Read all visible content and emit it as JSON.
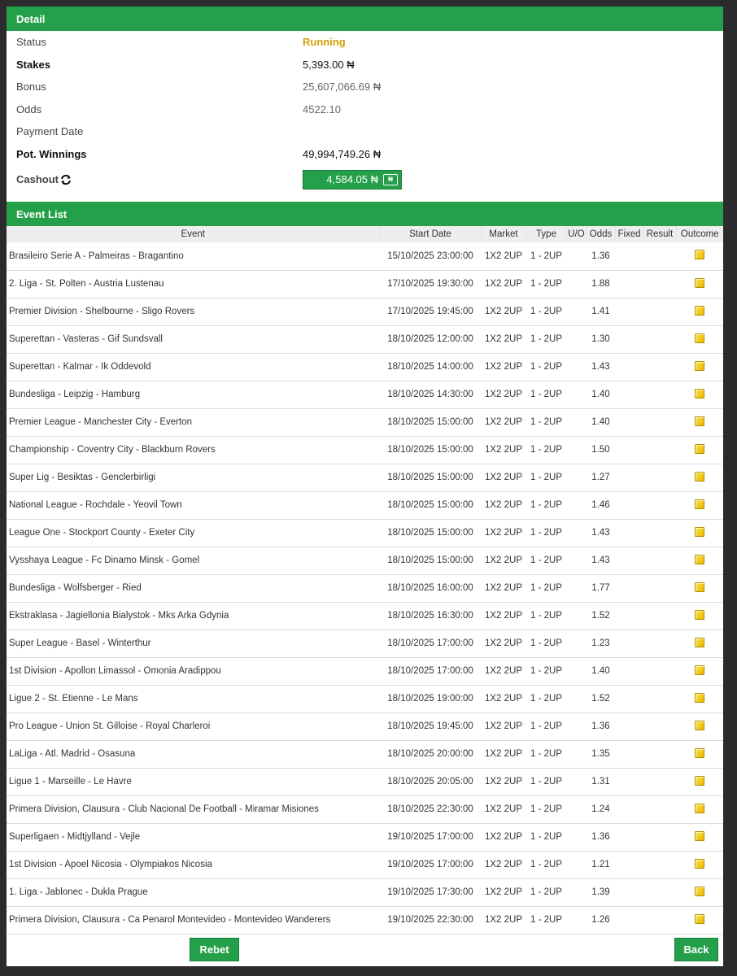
{
  "detail": {
    "header": "Detail",
    "rows": [
      {
        "label": "Status",
        "value": "Running"
      },
      {
        "label": "Stakes",
        "value": "5,393.00 ₦"
      },
      {
        "label": "Bonus",
        "value": "25,607,066.69 ₦"
      },
      {
        "label": "Odds",
        "value": "4522.10"
      },
      {
        "label": "Payment Date",
        "value": ""
      },
      {
        "label": "Pot. Winnings",
        "value": "49,994,749.26 ₦"
      }
    ],
    "cashout_label": "Cashout",
    "cashout_icon": "refresh-icon",
    "cashout_value": "4,584.05 ₦",
    "cashout_button_icon": "cash-note-icon",
    "cashout_button_icon_glyph": "₦"
  },
  "events": {
    "header": "Event List",
    "columns": [
      "Event",
      "Start Date",
      "Market",
      "Type",
      "U/O",
      "Odds",
      "Fixed",
      "Result",
      "Outcome"
    ],
    "rows": [
      {
        "event": "Brasileiro Serie A - Palmeiras - Bragantino",
        "start": "15/10/2025 23:00:00",
        "market": "1X2 2UP",
        "type": "1 - 2UP",
        "uo": "",
        "odds": "1.36",
        "fixed": "",
        "result": ""
      },
      {
        "event": "2. Liga - St. Polten - Austria Lustenau",
        "start": "17/10/2025 19:30:00",
        "market": "1X2 2UP",
        "type": "1 - 2UP",
        "uo": "",
        "odds": "1.88",
        "fixed": "",
        "result": ""
      },
      {
        "event": "Premier Division - Shelbourne - Sligo Rovers",
        "start": "17/10/2025 19:45:00",
        "market": "1X2 2UP",
        "type": "1 - 2UP",
        "uo": "",
        "odds": "1.41",
        "fixed": "",
        "result": ""
      },
      {
        "event": "Superettan - Vasteras - Gif Sundsvall",
        "start": "18/10/2025 12:00:00",
        "market": "1X2 2UP",
        "type": "1 - 2UP",
        "uo": "",
        "odds": "1.30",
        "fixed": "",
        "result": ""
      },
      {
        "event": "Superettan - Kalmar - Ik Oddevold",
        "start": "18/10/2025 14:00:00",
        "market": "1X2 2UP",
        "type": "1 - 2UP",
        "uo": "",
        "odds": "1.43",
        "fixed": "",
        "result": ""
      },
      {
        "event": "Bundesliga - Leipzig - Hamburg",
        "start": "18/10/2025 14:30:00",
        "market": "1X2 2UP",
        "type": "1 - 2UP",
        "uo": "",
        "odds": "1.40",
        "fixed": "",
        "result": ""
      },
      {
        "event": "Premier League - Manchester City - Everton",
        "start": "18/10/2025 15:00:00",
        "market": "1X2 2UP",
        "type": "1 - 2UP",
        "uo": "",
        "odds": "1.40",
        "fixed": "",
        "result": ""
      },
      {
        "event": "Championship - Coventry City - Blackburn Rovers",
        "start": "18/10/2025 15:00:00",
        "market": "1X2 2UP",
        "type": "1 - 2UP",
        "uo": "",
        "odds": "1.50",
        "fixed": "",
        "result": ""
      },
      {
        "event": "Super Lig - Besiktas - Genclerbirligi",
        "start": "18/10/2025 15:00:00",
        "market": "1X2 2UP",
        "type": "1 - 2UP",
        "uo": "",
        "odds": "1.27",
        "fixed": "",
        "result": ""
      },
      {
        "event": "National League - Rochdale - Yeovil Town",
        "start": "18/10/2025 15:00:00",
        "market": "1X2 2UP",
        "type": "1 - 2UP",
        "uo": "",
        "odds": "1.46",
        "fixed": "",
        "result": ""
      },
      {
        "event": "League One - Stockport County - Exeter City",
        "start": "18/10/2025 15:00:00",
        "market": "1X2 2UP",
        "type": "1 - 2UP",
        "uo": "",
        "odds": "1.43",
        "fixed": "",
        "result": ""
      },
      {
        "event": "Vysshaya League - Fc Dinamo Minsk - Gomel",
        "start": "18/10/2025 15:00:00",
        "market": "1X2 2UP",
        "type": "1 - 2UP",
        "uo": "",
        "odds": "1.43",
        "fixed": "",
        "result": ""
      },
      {
        "event": "Bundesliga - Wolfsberger - Ried",
        "start": "18/10/2025 16:00:00",
        "market": "1X2 2UP",
        "type": "1 - 2UP",
        "uo": "",
        "odds": "1.77",
        "fixed": "",
        "result": ""
      },
      {
        "event": "Ekstraklasa - Jagiellonia Bialystok - Mks Arka Gdynia",
        "start": "18/10/2025 16:30:00",
        "market": "1X2 2UP",
        "type": "1 - 2UP",
        "uo": "",
        "odds": "1.52",
        "fixed": "",
        "result": ""
      },
      {
        "event": "Super League - Basel - Winterthur",
        "start": "18/10/2025 17:00:00",
        "market": "1X2 2UP",
        "type": "1 - 2UP",
        "uo": "",
        "odds": "1.23",
        "fixed": "",
        "result": ""
      },
      {
        "event": "1st Division - Apollon Limassol - Omonia Aradippou",
        "start": "18/10/2025 17:00:00",
        "market": "1X2 2UP",
        "type": "1 - 2UP",
        "uo": "",
        "odds": "1.40",
        "fixed": "",
        "result": ""
      },
      {
        "event": "Ligue 2 - St. Etienne - Le Mans",
        "start": "18/10/2025 19:00:00",
        "market": "1X2 2UP",
        "type": "1 - 2UP",
        "uo": "",
        "odds": "1.52",
        "fixed": "",
        "result": ""
      },
      {
        "event": "Pro League - Union St. Gilloise - Royal Charleroi",
        "start": "18/10/2025 19:45:00",
        "market": "1X2 2UP",
        "type": "1 - 2UP",
        "uo": "",
        "odds": "1.36",
        "fixed": "",
        "result": ""
      },
      {
        "event": "LaLiga - Atl. Madrid - Osasuna",
        "start": "18/10/2025 20:00:00",
        "market": "1X2 2UP",
        "type": "1 - 2UP",
        "uo": "",
        "odds": "1.35",
        "fixed": "",
        "result": ""
      },
      {
        "event": "Ligue 1 - Marseille - Le Havre",
        "start": "18/10/2025 20:05:00",
        "market": "1X2 2UP",
        "type": "1 - 2UP",
        "uo": "",
        "odds": "1.31",
        "fixed": "",
        "result": ""
      },
      {
        "event": "Primera Division, Clausura - Club Nacional De Football - Miramar Misiones",
        "start": "18/10/2025 22:30:00",
        "market": "1X2 2UP",
        "type": "1 - 2UP",
        "uo": "",
        "odds": "1.24",
        "fixed": "",
        "result": ""
      },
      {
        "event": "Superligaen - Midtjylland - Vejle",
        "start": "19/10/2025 17:00:00",
        "market": "1X2 2UP",
        "type": "1 - 2UP",
        "uo": "",
        "odds": "1.36",
        "fixed": "",
        "result": ""
      },
      {
        "event": "1st Division - Apoel Nicosia - Olympiakos Nicosia",
        "start": "19/10/2025 17:00:00",
        "market": "1X2 2UP",
        "type": "1 - 2UP",
        "uo": "",
        "odds": "1.21",
        "fixed": "",
        "result": ""
      },
      {
        "event": "1. Liga - Jablonec - Dukla Prague",
        "start": "19/10/2025 17:30:00",
        "market": "1X2 2UP",
        "type": "1 - 2UP",
        "uo": "",
        "odds": "1.39",
        "fixed": "",
        "result": ""
      },
      {
        "event": "Primera Division, Clausura - Ca Penarol Montevideo - Montevideo Wanderers",
        "start": "19/10/2025 22:30:00",
        "market": "1X2 2UP",
        "type": "1 - 2UP",
        "uo": "",
        "odds": "1.26",
        "fixed": "",
        "result": ""
      }
    ],
    "outcome_icon": "pending-outcome-icon"
  },
  "footer": {
    "rebet_label": "Rebet",
    "back_label": "Back"
  },
  "colors": {
    "header_green": "#23a049",
    "status_running": "#d4a30a",
    "page_background": "#2b2b2d"
  }
}
